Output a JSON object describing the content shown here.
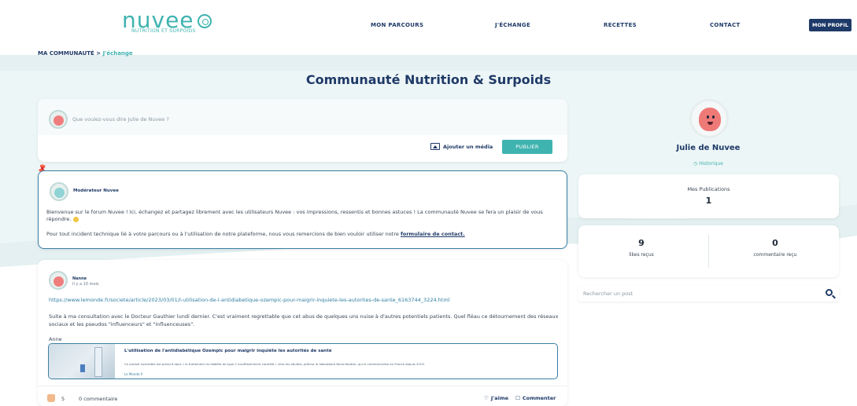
{
  "header": {
    "logo_text": "nuvee",
    "logo_sub": "NUTRITION ET SURPOIDS",
    "nav": [
      "MON PARCOURS",
      "J'ÉCHANGE",
      "RECETTES",
      "CONTACT"
    ],
    "profile_button": "MON PROFIL"
  },
  "breadcrumb": {
    "parent": "MA COMMUNAUTÉ",
    "separator": ">",
    "current": "J'échange"
  },
  "page_title": "Communauté Nutrition & Surpoids",
  "composer": {
    "placeholder": "Que voulez-vous dire Julie de Nuvee ?",
    "media_label": "Ajouter un média",
    "publish_label": "PUBLIER"
  },
  "pinned_post": {
    "author": "Modérateur Nuvee",
    "text1": "Bienvenue sur le forum Nuvee ! Ici, échangez et partagez librement avec les utilisateurs Nuvee : vos impressions, ressentis et bonnes astuces ! La communauté Nuvee se fera un plaisir de vous répondre.",
    "text2": "Pour tout incident technique lié à votre parcours ou à l'utilisation de notre plateforme, nous vous remercions de bien vouloir utiliser notre",
    "link": "formulaire de contact."
  },
  "post": {
    "author": "Nanne",
    "time": "Il y a 10 mois",
    "url": "https://www.lemonde.fr/societe/article/2023/03/01/l-utilisation-de-l-antidiabetique-ozempic-pour-maigrir-inquiete-les-autorites-de-sante_6163744_3224.html",
    "text": "Suite à ma consultation avec le Docteur Gauthier lundi dernier. C'est vraiment regrettable que cet abus de quelques uns nuise à d'autres potentiels patients. Quel fléau ce détournement des réseaux sociaux et les pseudos \"influenceurs\" et \"influenceuses\".",
    "signature": "Anne",
    "preview": {
      "title": "L'utilisation de l'antidiabétique Ozempic pour maigrir inquiète les autorités de santé",
      "description": "Ce produit injectable est prescrit dans « le traitement du diabète de type 2 insuffisamment contrôlé » chez les adultes, précise le laboratoire Novo Nordisk, qui le commercialise en France depuis 2019.",
      "source": "Le Monde.fr"
    },
    "likes": "5",
    "comments": "0 commentaire",
    "like_label": "J'aime",
    "comment_label": "Commenter"
  },
  "profile": {
    "name": "Julie de Nuvee",
    "history": "Historique",
    "publications_label": "Mes Publications",
    "publications_value": "1",
    "likes_value": "9",
    "likes_label": "likes reçus",
    "comments_value": "0",
    "comments_label": "commentaire reçu"
  },
  "search": {
    "placeholder": "Rechercher un post"
  },
  "colors": {
    "brand": "#3fb3b0",
    "navy": "#1f3a68"
  }
}
